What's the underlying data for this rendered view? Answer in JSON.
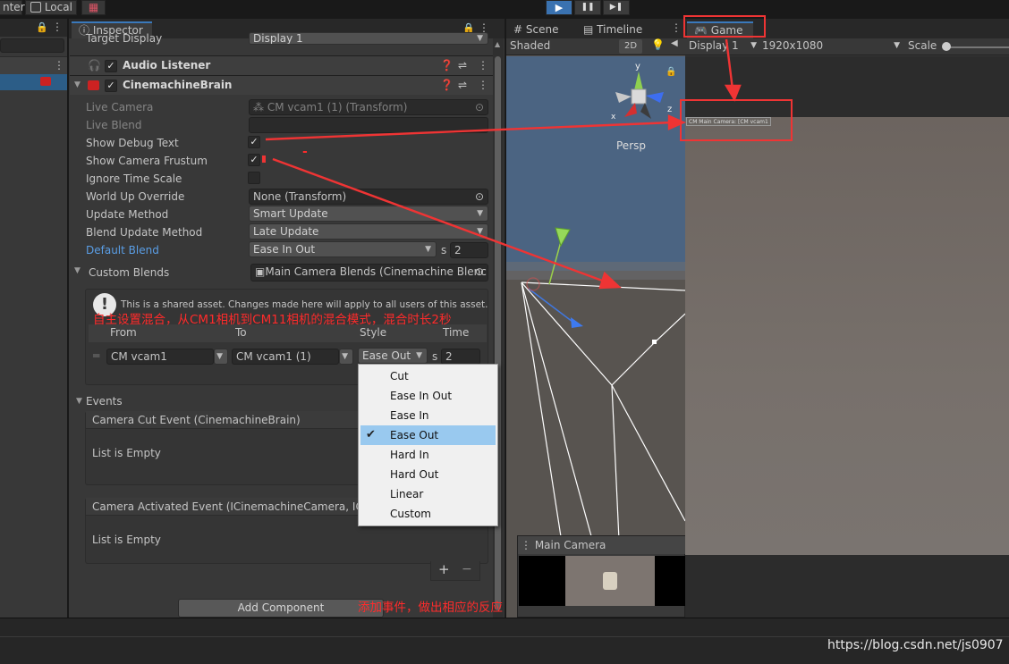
{
  "toolbar": {
    "center_label": "nter",
    "local_label": "Local",
    "play": "▶",
    "pause": "❚❚",
    "step": "▶❚"
  },
  "inspector": {
    "tab": "Inspector",
    "target_display_label": "Target Display",
    "target_display_value": "Display 1",
    "audio_listener": "Audio Listener",
    "cinemachine_brain": "CinemachineBrain",
    "live_camera_label": "Live Camera",
    "live_camera_value": "CM vcam1 (1) (Transform)",
    "live_blend_label": "Live Blend",
    "show_debug_text": "Show Debug Text",
    "show_camera_frustum": "Show Camera Frustum",
    "ignore_time_scale": "Ignore Time Scale",
    "world_up_label": "World Up Override",
    "world_up_value": "None (Transform)",
    "update_method_label": "Update Method",
    "update_method_value": "Smart Update",
    "blend_update_label": "Blend Update Method",
    "blend_update_value": "Late Update",
    "default_blend_label": "Default Blend",
    "default_blend_value": "Ease In Out",
    "default_blend_s": "s",
    "default_blend_time": "2",
    "custom_blends_label": "Custom Blends",
    "custom_blends_value": "Main Camera Blends (Cinemachine Blenc",
    "shared_warning": "This is a shared asset.  Changes made here will apply to all users of this asset.",
    "col_from": "From",
    "col_to": "To",
    "col_style": "Style",
    "col_time": "Time",
    "blend_from": "CM vcam1",
    "blend_to": "CM vcam1 (1)",
    "blend_style": "Ease Out",
    "blend_s": "s",
    "blend_time": "2",
    "events_label": "Events",
    "cut_event": "Camera Cut Event (CinemachineBrain)",
    "cut_empty": "List is Empty",
    "activated_event": "Camera Activated Event (ICinemachineCamera, ICine",
    "activated_empty": "List is Empty",
    "plus": "+",
    "minus": "−",
    "add_component": "Add Component"
  },
  "scene": {
    "tab_scene": "Scene",
    "tab_timeline": "Timeline",
    "shaded": "Shaded",
    "btn_2d": "2D",
    "persp": "Persp",
    "axis_y": "y",
    "axis_z": "z",
    "axis_x": "x",
    "main_camera": "Main Camera"
  },
  "game": {
    "tab": "Game",
    "display": "Display 1",
    "resolution": "1920x1080",
    "scale": "Scale",
    "debug_text": "CM Main Camera: [CM vcam1 (1)]"
  },
  "dropdown": {
    "items": [
      "Cut",
      "Ease In Out",
      "Ease In",
      "Ease Out",
      "Hard In",
      "Hard Out",
      "Linear",
      "Custom"
    ],
    "selected": "Ease Out"
  },
  "annotations": {
    "note1": "自主设置混合，从CM1相机到CM11相机的混合模式，混合时长2秒",
    "note2": "添加事件，做出相应的反应",
    "dash": "-"
  },
  "watermark": "https://blog.csdn.net/js0907",
  "colors": {
    "annotation": "#ef3434",
    "accent": "#3a79bb",
    "selection": "#99c9ef"
  }
}
